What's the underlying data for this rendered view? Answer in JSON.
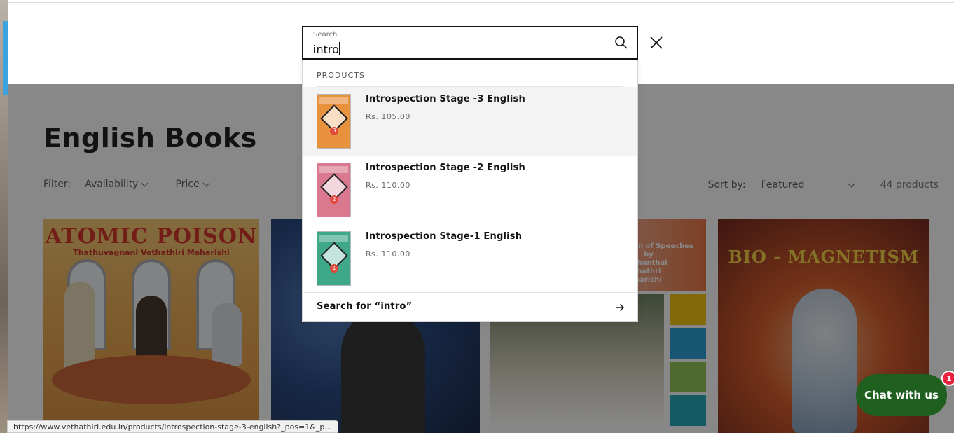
{
  "search": {
    "label": "Search",
    "query": "intro"
  },
  "predictive": {
    "heading": "PRODUCTS",
    "products": [
      {
        "title": "Introspection Stage -3 English",
        "price": "Rs. 105.00",
        "stage": "3",
        "color": "#e8923d"
      },
      {
        "title": "Introspection Stage -2 English",
        "price": "Rs. 110.00",
        "stage": "2",
        "color": "#d9788f"
      },
      {
        "title": "Introspection Stage-1 English",
        "price": "Rs. 110.00",
        "stage": "1",
        "color": "#3fa889"
      }
    ],
    "search_for": "Search for “intro”"
  },
  "collection": {
    "title": "English Books",
    "filter_label": "Filter:",
    "filters": [
      "Availability",
      "Price"
    ],
    "sort_label": "Sort by:",
    "sort_value": "Featured",
    "product_count": "44 products"
  },
  "books": [
    {
      "title": "ATOMIC POISON",
      "author": "Thathuvagnani Vethathiri Maharishi"
    },
    {
      "title": ""
    },
    {
      "subtitle": "Collection of Speeches",
      "by": "by",
      "author": "Arulthanthai Vethathri Maharishi"
    },
    {
      "title": "BIO - MAGNETISM"
    }
  ],
  "status_url": "https://www.vethathiri.edu.in/products/introspection-stage-3-english?_pos=1&_p...",
  "chat": {
    "label": "Chat with us",
    "badge": "1",
    "color": "#1f5f1f"
  }
}
